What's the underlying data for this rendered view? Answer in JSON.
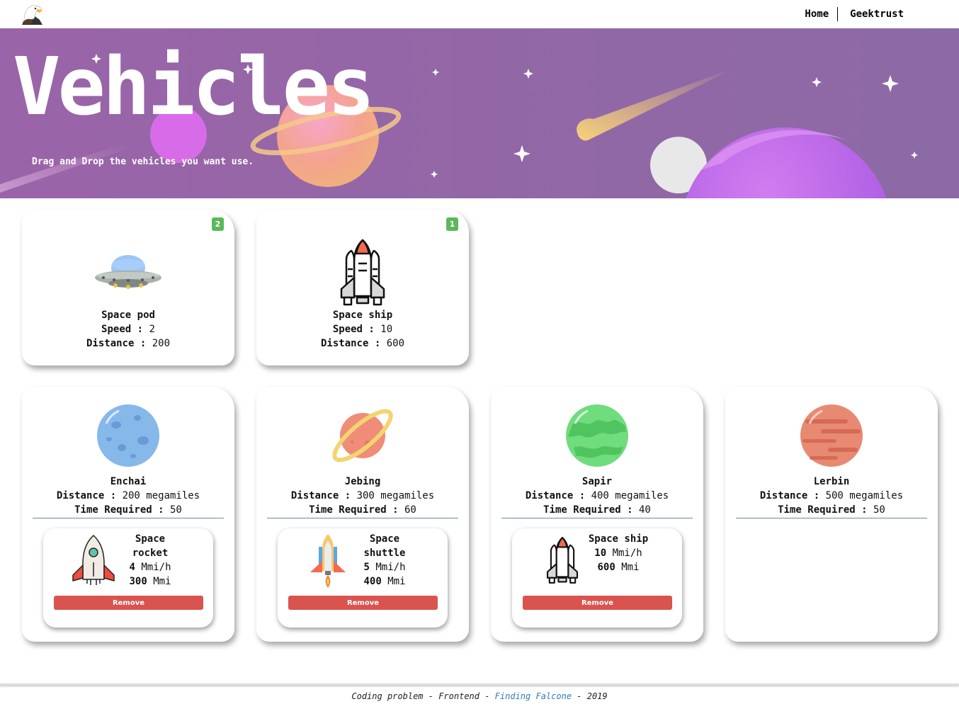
{
  "nav": {
    "logo": "eagle-logo",
    "links": [
      "Home",
      "Geektrust"
    ]
  },
  "hero": {
    "title": "Vehicles",
    "subtitle": "Drag and Drop the vehicles you want use."
  },
  "vehicles": [
    {
      "name": "Space pod",
      "speed_label": "Speed :",
      "speed": "2",
      "distance_label": "Distance :",
      "distance": "200",
      "count": "2",
      "icon": "ufo-icon"
    },
    {
      "name": "Space ship",
      "speed_label": "Speed :",
      "speed": "10",
      "distance_label": "Distance :",
      "distance": "600",
      "count": "1",
      "icon": "space-shuttle-icon"
    }
  ],
  "planets": [
    {
      "name": "Enchai",
      "distance_label": "Distance :",
      "distance": "200 megamiles",
      "time_label": "Time Required :",
      "time": "50",
      "color": "#86b8ea",
      "assigned": {
        "name_line1": "Space",
        "name_line2": "rocket",
        "speed": "4",
        "speed_unit": "Mmi/h",
        "max": "300",
        "max_unit": "Mmi",
        "remove": "Remove"
      }
    },
    {
      "name": "Jebing",
      "distance_label": "Distance :",
      "distance": "300 megamiles",
      "time_label": "Time Required :",
      "time": "60",
      "color": "#ef8d78",
      "assigned": {
        "name_line1": "Space",
        "name_line2": "shuttle",
        "speed": "5",
        "speed_unit": "Mmi/h",
        "max": "400",
        "max_unit": "Mmi",
        "remove": "Remove"
      }
    },
    {
      "name": "Sapir",
      "distance_label": "Distance :",
      "distance": "400 megamiles",
      "time_label": "Time Required :",
      "time": "40",
      "color": "#6fdc7d",
      "assigned": {
        "name_line1": "Space ship",
        "name_line2": "",
        "speed": "10",
        "speed_unit": "Mmi/h",
        "max": "600",
        "max_unit": "Mmi",
        "remove": "Remove"
      }
    },
    {
      "name": "Lerbin",
      "distance_label": "Distance :",
      "distance": "500 megamiles",
      "time_label": "Time Required :",
      "time": "50",
      "color": "#e88a72"
    }
  ],
  "footer": {
    "prefix": "Coding problem - Frontend - ",
    "link": "Finding Falcone",
    "suffix": " - 2019"
  },
  "colors": {
    "hero": "#9766a6",
    "badge": "#5cb85c",
    "remove": "#d9534f",
    "link": "#337ab7"
  }
}
